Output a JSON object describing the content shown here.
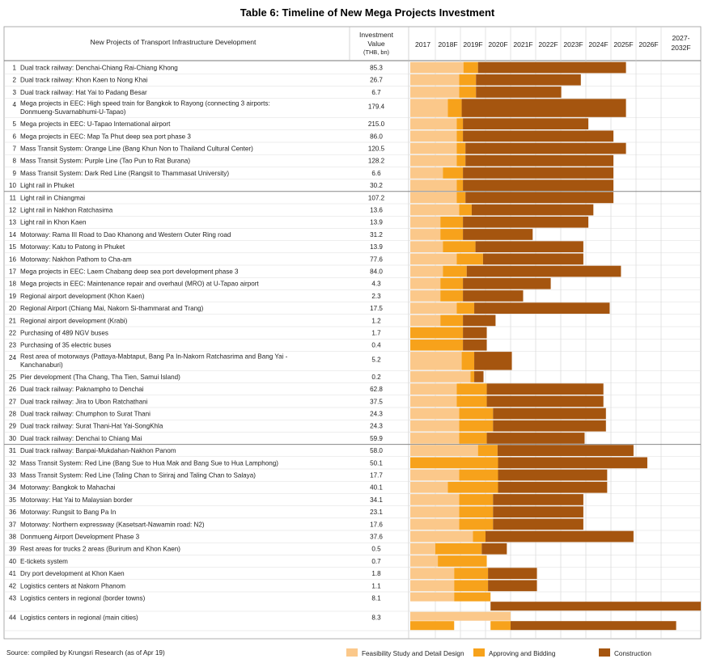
{
  "chart_data": {
    "type": "table",
    "title": "Table 6: Timeline of New Mega Projects Investment",
    "columns": {
      "project": "New Projects of Transport Infrastructure Development",
      "value": "Investment Value (THB, bn)",
      "years": [
        "2017",
        "2018F",
        "2019F",
        "2020F",
        "2021F",
        "2022F",
        "2023F",
        "2024F",
        "2025F",
        "2026F",
        "2027-2032F"
      ]
    },
    "phases": [
      {
        "key": "f",
        "name": "Feasibility Study and Detail Design",
        "color": "#FBC88A"
      },
      {
        "key": "a",
        "name": "Approving and Bidding",
        "color": "#F7A21B"
      },
      {
        "key": "c",
        "name": "Construction",
        "color": "#A5550F"
      }
    ],
    "rows": [
      {
        "no": "1",
        "name": "Dual track railway: Denchai-Chiang Rai-Chiang Khong",
        "value": "85.3",
        "phases": [
          [
            "f",
            0,
            2.12
          ],
          [
            "a",
            2.12,
            2.7
          ],
          [
            "c",
            2.7,
            8.6
          ]
        ]
      },
      {
        "no": "2",
        "name": "Dual track railway: Khon Kaen to Nong Khai",
        "value": "26.7",
        "phases": [
          [
            "f",
            0,
            1.95
          ],
          [
            "a",
            1.95,
            2.62
          ],
          [
            "c",
            2.62,
            6.8
          ]
        ]
      },
      {
        "no": "3",
        "name": "Dual track railway: Hat Yai to Padang Besar",
        "value": "6.7",
        "phases": [
          [
            "f",
            0,
            1.95
          ],
          [
            "a",
            1.95,
            2.62
          ],
          [
            "c",
            2.62,
            6.02
          ]
        ]
      },
      {
        "no": "4",
        "name": "Mega projects in EEC: High speed train for Bangkok to Rayong (connecting 3 airports: Donmueng-Suvarnabhumi-U-Tapao)",
        "value": "179.4",
        "two": true,
        "phases": [
          [
            "f",
            0,
            1.5
          ],
          [
            "a",
            1.5,
            2.05
          ],
          [
            "c",
            2.05,
            8.6
          ]
        ]
      },
      {
        "no": "5",
        "name": "Mega projects in EEC: U-Tapao International airport",
        "value": "215.0",
        "phases": [
          [
            "f",
            0,
            1.85
          ],
          [
            "a",
            1.85,
            2.1
          ],
          [
            "c",
            2.1,
            7.1
          ]
        ]
      },
      {
        "no": "6",
        "name": "Mega projects in EEC: Map Ta Phut deep sea port phase 3",
        "value": "86.0",
        "phases": [
          [
            "f",
            0,
            1.85
          ],
          [
            "a",
            1.85,
            2.1
          ],
          [
            "c",
            2.1,
            8.1
          ]
        ]
      },
      {
        "no": "7",
        "name": "Mass Transit System: Orange Line (Bang Khun Non to Thailand Cultural Center)",
        "value": "120.5",
        "phases": [
          [
            "f",
            0,
            1.85
          ],
          [
            "a",
            1.85,
            2.2
          ],
          [
            "c",
            2.2,
            8.6
          ]
        ]
      },
      {
        "no": "8",
        "name": "Mass Transit System: Purple Line (Tao Pun to Rat Burana)",
        "value": "128.2",
        "phases": [
          [
            "f",
            0,
            1.85
          ],
          [
            "a",
            1.85,
            2.2
          ],
          [
            "c",
            2.2,
            8.1
          ]
        ]
      },
      {
        "no": "9",
        "name": "Mass Transit System: Dark Red Line (Rangsit to Thammasat University)",
        "value": "6.6",
        "phases": [
          [
            "f",
            0,
            1.3
          ],
          [
            "a",
            1.3,
            2.1
          ],
          [
            "c",
            2.1,
            8.1
          ]
        ]
      },
      {
        "no": "10",
        "name": "Light rail in Phuket",
        "value": "30.2",
        "phases": [
          [
            "f",
            0,
            1.85
          ],
          [
            "a",
            1.85,
            2.1
          ],
          [
            "c",
            2.1,
            8.1
          ]
        ]
      },
      {
        "no": "11",
        "name": "Light rail in Chiangmai",
        "value": "107.2",
        "phases": [
          [
            "f",
            0,
            1.85
          ],
          [
            "a",
            1.85,
            2.2
          ],
          [
            "c",
            2.2,
            8.1
          ]
        ]
      },
      {
        "no": "12",
        "name": "Light rail in Nakhon Ratchasima",
        "value": "13.6",
        "phases": [
          [
            "f",
            0,
            1.95
          ],
          [
            "a",
            1.95,
            2.45
          ],
          [
            "c",
            2.45,
            7.3
          ]
        ]
      },
      {
        "no": "13",
        "name": "Light rail in Khon Kaen",
        "value": "13.9",
        "phases": [
          [
            "f",
            0,
            1.2
          ],
          [
            "a",
            1.2,
            2.1
          ],
          [
            "c",
            2.1,
            7.1
          ]
        ]
      },
      {
        "no": "14",
        "name": "Motorway: Rama III Road to Dao Khanong and Western Outer Ring road",
        "value": "31.2",
        "phases": [
          [
            "f",
            0,
            1.2
          ],
          [
            "a",
            1.2,
            2.1
          ],
          [
            "c",
            2.1,
            4.88
          ]
        ]
      },
      {
        "no": "15",
        "name": "Motorway: Katu to Patong in Phuket",
        "value": "13.9",
        "phases": [
          [
            "f",
            0,
            1.3
          ],
          [
            "a",
            1.3,
            2.6
          ],
          [
            "c",
            2.6,
            6.9
          ]
        ]
      },
      {
        "no": "16",
        "name": "Motorway: Nakhon Pathom to Cha-am",
        "value": "77.6",
        "phases": [
          [
            "f",
            0,
            1.85
          ],
          [
            "a",
            1.85,
            2.9
          ],
          [
            "c",
            2.9,
            6.9
          ]
        ]
      },
      {
        "no": "17",
        "name": "Mega projects in EEC: Laem Chabang deep sea port development phase 3",
        "value": "84.0",
        "phases": [
          [
            "f",
            0,
            1.3
          ],
          [
            "a",
            1.3,
            2.25
          ],
          [
            "c",
            2.25,
            8.4
          ]
        ]
      },
      {
        "no": "18",
        "name": "Mega projects in EEC: Maintenance repair and overhaul (MRO) at U-Tapao airport",
        "value": "4.3",
        "phases": [
          [
            "f",
            0,
            1.2
          ],
          [
            "a",
            1.2,
            2.1
          ],
          [
            "c",
            2.1,
            5.6
          ]
        ]
      },
      {
        "no": "19",
        "name": "Regional airport development (Khon Kaen)",
        "value": "2.3",
        "phases": [
          [
            "f",
            0,
            1.2
          ],
          [
            "a",
            1.2,
            2.1
          ],
          [
            "c",
            2.1,
            4.5
          ]
        ]
      },
      {
        "no": "20",
        "name": "Regional Airport (Chiang Mai, Nakorn Si-thammarat and Trang)",
        "value": "17.5",
        "phases": [
          [
            "f",
            0,
            1.85
          ],
          [
            "a",
            1.85,
            2.55
          ],
          [
            "c",
            2.55,
            7.95
          ]
        ]
      },
      {
        "no": "21",
        "name": "Regional airport development (Krabi)",
        "value": "1.2",
        "phases": [
          [
            "f",
            0,
            1.2
          ],
          [
            "a",
            1.2,
            2.1
          ],
          [
            "c",
            2.1,
            3.4
          ]
        ]
      },
      {
        "no": "22",
        "name": "Purchasing of 489 NGV buses",
        "value": "1.7",
        "phases": [
          [
            "a",
            0,
            2.1
          ],
          [
            "c",
            2.1,
            3.05
          ]
        ]
      },
      {
        "no": "23",
        "name": "Purchasing of 35 electric buses",
        "value": "0.4",
        "phases": [
          [
            "a",
            0,
            2.1
          ],
          [
            "c",
            2.1,
            3.05
          ]
        ]
      },
      {
        "no": "24",
        "name": "Rest area of motorways (Pattaya-Mabtaput, Bang Pa In-Nakorn Ratchasrima and Bang Yai - Kanchanaburi)",
        "value": "5.2",
        "two": true,
        "phases": [
          [
            "f",
            0,
            2.05
          ],
          [
            "a",
            2.05,
            2.55
          ],
          [
            "c",
            2.55,
            4.05
          ]
        ]
      },
      {
        "no": "25",
        "name": "Pier development (Tha Chang, Tha Tien, Samui Island)",
        "value": "0.2",
        "phases": [
          [
            "f",
            0,
            2.4
          ],
          [
            "a",
            2.4,
            2.55
          ],
          [
            "c",
            2.55,
            2.92
          ]
        ]
      },
      {
        "no": "26",
        "name": "Dual track railway: Paknampho to Denchai",
        "value": "62.8",
        "phases": [
          [
            "f",
            0,
            1.85
          ],
          [
            "a",
            1.85,
            3.05
          ],
          [
            "c",
            3.05,
            7.7
          ]
        ]
      },
      {
        "no": "27",
        "name": "Dual track railway: Jira to Ubon Ratchathani",
        "value": "37.5",
        "phases": [
          [
            "f",
            0,
            1.85
          ],
          [
            "a",
            1.85,
            3.05
          ],
          [
            "c",
            3.05,
            7.7
          ]
        ]
      },
      {
        "no": "28",
        "name": "Dual track railway: Chumphon to Surat Thani",
        "value": "24.3",
        "phases": [
          [
            "f",
            0,
            1.95
          ],
          [
            "a",
            1.95,
            3.3
          ],
          [
            "c",
            3.3,
            7.8
          ]
        ]
      },
      {
        "no": "29",
        "name": "Dual track railway: Surat Thani-Hat Yai-SongKhla",
        "value": "24.3",
        "phases": [
          [
            "f",
            0,
            1.95
          ],
          [
            "a",
            1.95,
            3.3
          ],
          [
            "c",
            3.3,
            7.8
          ]
        ]
      },
      {
        "no": "30",
        "name": "Dual track railway: Denchai to Chiang Mai",
        "value": "59.9",
        "phases": [
          [
            "f",
            0,
            1.95
          ],
          [
            "a",
            1.95,
            3.05
          ],
          [
            "c",
            3.05,
            6.95
          ]
        ]
      },
      {
        "no": "31",
        "name": "Dual track railway: Banpai-Mukdahan-Nakhon Panom",
        "value": "58.0",
        "phases": [
          [
            "f",
            0,
            2.7
          ],
          [
            "a",
            2.7,
            3.48
          ],
          [
            "c",
            3.48,
            8.9
          ]
        ]
      },
      {
        "no": "32",
        "name": "Mass Transit System: Red Line (Bang Sue to Hua Mak and Bang Sue to Hua Lamphong)",
        "value": "50.1",
        "phases": [
          [
            "a",
            0,
            3.5
          ],
          [
            "c",
            3.5,
            9.45
          ]
        ]
      },
      {
        "no": "33",
        "name": "Mass Transit System: Red Line (Taling Chan to Siriraj and Taling Chan to Salaya)",
        "value": "17.7",
        "phases": [
          [
            "f",
            0,
            1.95
          ],
          [
            "a",
            1.95,
            3.5
          ],
          [
            "c",
            3.5,
            7.85
          ]
        ]
      },
      {
        "no": "34",
        "name": "Motorway: Bangkok to Mahachai",
        "value": "40.1",
        "phases": [
          [
            "f",
            0,
            1.5
          ],
          [
            "a",
            1.5,
            3.5
          ],
          [
            "c",
            3.5,
            7.85
          ]
        ]
      },
      {
        "no": "35",
        "name": "Motorway: Hat Yai to Malaysian border",
        "value": "34.1",
        "phases": [
          [
            "f",
            0,
            1.95
          ],
          [
            "a",
            1.95,
            3.3
          ],
          [
            "c",
            3.3,
            6.9
          ]
        ]
      },
      {
        "no": "36",
        "name": "Motorway: Rungsit to Bang Pa In",
        "value": "23.1",
        "phases": [
          [
            "f",
            0,
            1.95
          ],
          [
            "a",
            1.95,
            3.3
          ],
          [
            "c",
            3.3,
            6.9
          ]
        ]
      },
      {
        "no": "37",
        "name": "Motorway: Northern expressway (Kasetsart-Nawamin road: N2)",
        "value": "17.6",
        "phases": [
          [
            "f",
            0,
            1.95
          ],
          [
            "a",
            1.95,
            3.3
          ],
          [
            "c",
            3.3,
            6.9
          ]
        ]
      },
      {
        "no": "38",
        "name": "Donmueng Airport Development Phase 3",
        "value": "37.6",
        "phases": [
          [
            "f",
            0,
            2.5
          ],
          [
            "a",
            2.5,
            3.0
          ],
          [
            "c",
            3.0,
            8.9
          ]
        ]
      },
      {
        "no": "39",
        "name": "Rest areas for trucks 2 areas (Burirum and Khon Kaen)",
        "value": "0.5",
        "phases": [
          [
            "f",
            0,
            1.0
          ],
          [
            "a",
            1.0,
            2.85
          ],
          [
            "c",
            2.85,
            3.85
          ]
        ]
      },
      {
        "no": "40",
        "name": "E-tickets system",
        "value": "0.7",
        "phases": [
          [
            "f",
            0,
            1.1
          ],
          [
            "a",
            1.1,
            3.05
          ]
        ]
      },
      {
        "no": "41",
        "name": "Dry port development at Khon Kaen",
        "value": "1.8",
        "phases": [
          [
            "f",
            0,
            1.75
          ],
          [
            "a",
            1.75,
            3.1
          ],
          [
            "c",
            3.1,
            5.05
          ]
        ]
      },
      {
        "no": "42",
        "name": "Logistics centers at Nakorn Phanom",
        "value": "1.1",
        "phases": [
          [
            "f",
            0,
            1.75
          ],
          [
            "a",
            1.75,
            3.1
          ],
          [
            "c",
            3.1,
            5.05
          ]
        ]
      },
      {
        "no": "43",
        "name": "Logistics centers in regional (border towns)",
        "value": "8.1",
        "phases": [
          [
            "f",
            0,
            1.75
          ],
          [
            "a",
            1.75,
            3.2
          ]
        ],
        "extra": [
          [
            "c",
            3.2,
            11.8
          ]
        ]
      },
      {
        "no": "44",
        "name": "Logistics centers in regional (main cities)",
        "value": "8.3",
        "phases": [
          [
            "f",
            0,
            4.0
          ]
        ],
        "extra": [
          [
            "a",
            0,
            1.75
          ],
          [
            "a",
            3.2,
            4.0
          ],
          [
            "c",
            4.0,
            10.6
          ]
        ]
      }
    ],
    "source": "Source: compiled by Krungsri Research (as of Apr 19)"
  }
}
